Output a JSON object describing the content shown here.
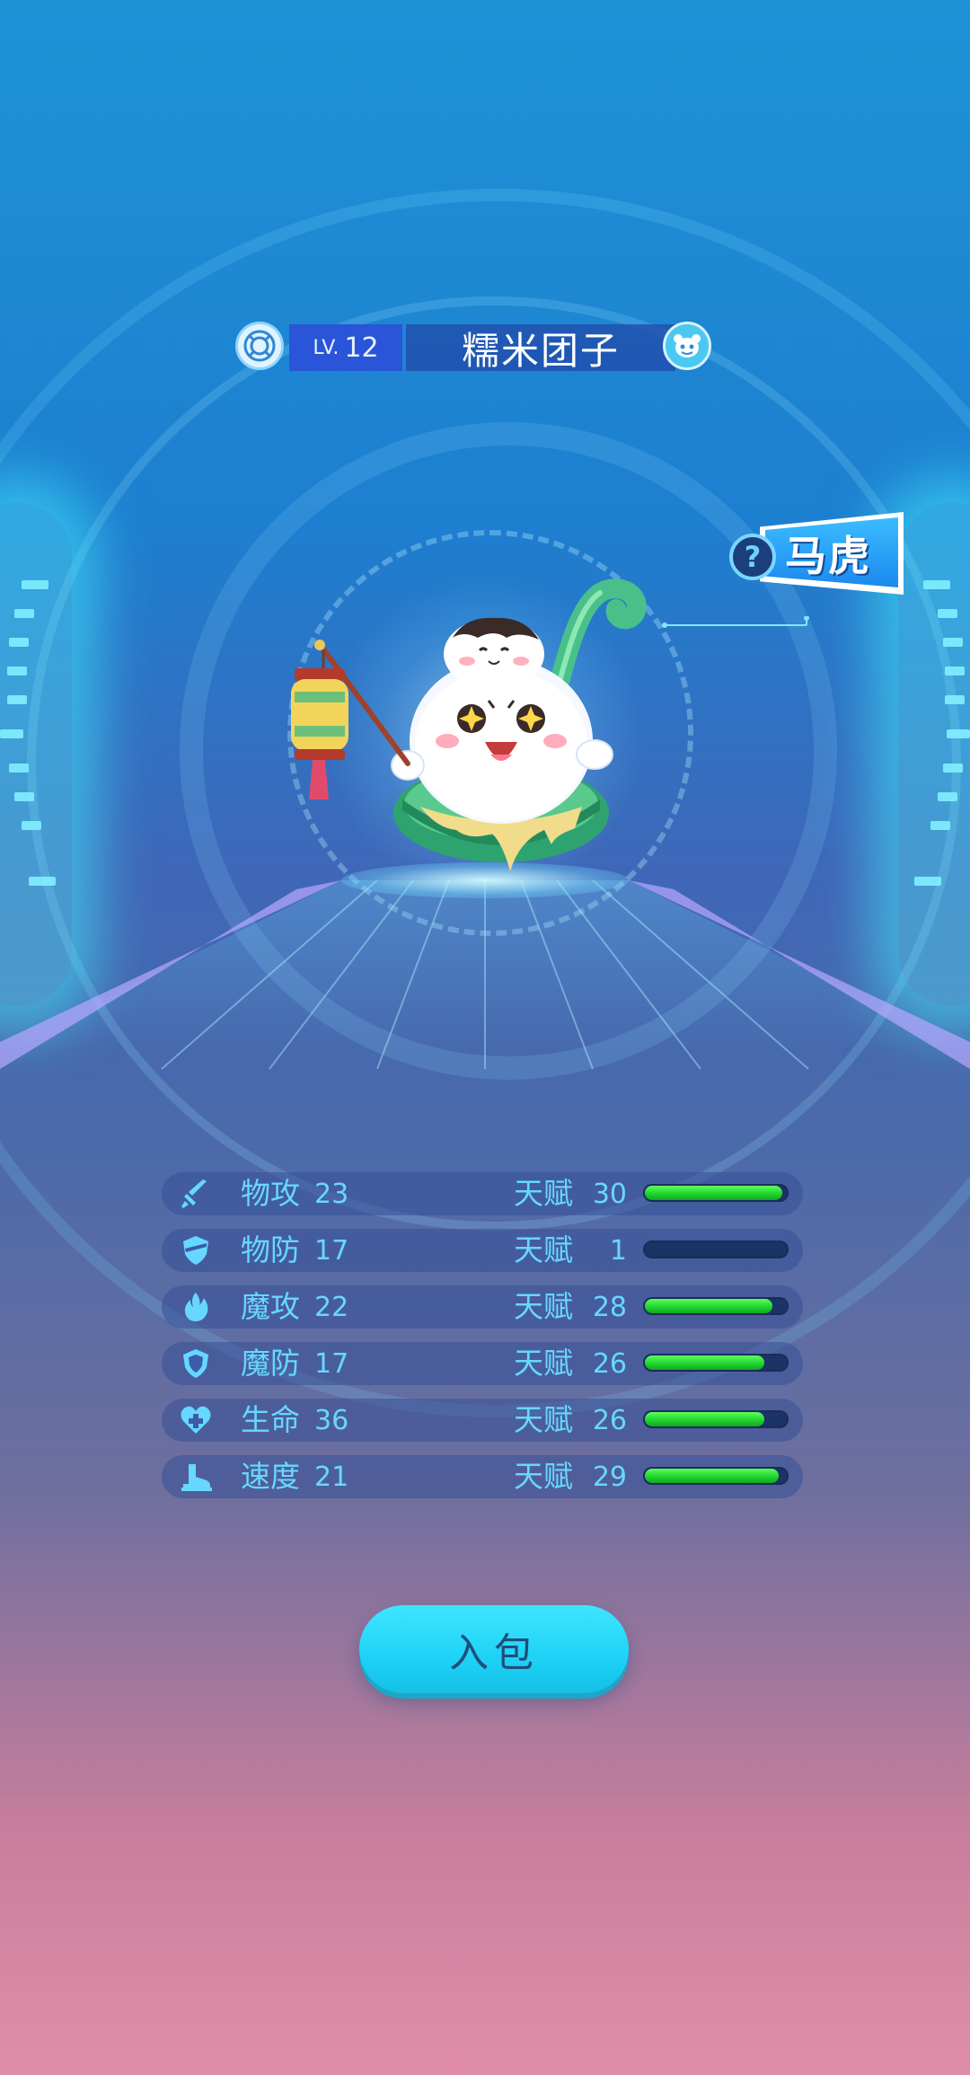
{
  "header": {
    "level_prefix": "LV.",
    "level": "12",
    "pet_name": "糯米团子"
  },
  "personality_tag": {
    "question_mark": "?",
    "label": "马虎"
  },
  "stats": [
    {
      "icon": "sword-icon",
      "label": "物攻",
      "value": "23",
      "talent_label": "天赋",
      "talent": "30",
      "talent_fraction": 0.97
    },
    {
      "icon": "shield-icon",
      "label": "物防",
      "value": "17",
      "talent_label": "天赋",
      "talent": "1",
      "talent_fraction": 0.0
    },
    {
      "icon": "fire-icon",
      "label": "魔攻",
      "value": "22",
      "talent_label": "天赋",
      "talent": "28",
      "talent_fraction": 0.9
    },
    {
      "icon": "magic-shield-icon",
      "label": "魔防",
      "value": "17",
      "talent_label": "天赋",
      "talent": "26",
      "talent_fraction": 0.84
    },
    {
      "icon": "heart-plus-icon",
      "label": "生命",
      "value": "36",
      "talent_label": "天赋",
      "talent": "26",
      "talent_fraction": 0.84
    },
    {
      "icon": "boot-icon",
      "label": "速度",
      "value": "21",
      "talent_label": "天赋",
      "talent": "29",
      "talent_fraction": 0.94
    }
  ],
  "action_button": {
    "label": "入包"
  },
  "colors": {
    "stat_text": "#66d8ff",
    "bar_fill": "#21d52f",
    "button": "#1ed2f6"
  }
}
